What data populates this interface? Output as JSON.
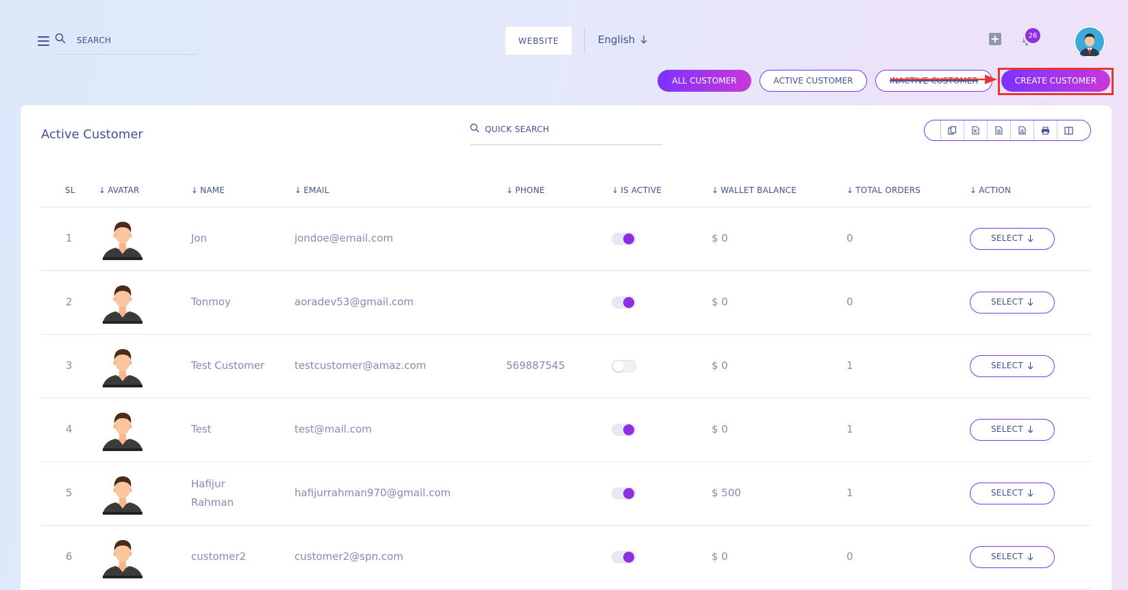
{
  "topbar": {
    "search_placeholder": "SEARCH",
    "website_label": "WEBSITE",
    "language": "English",
    "notification_count": "26"
  },
  "filters": {
    "all": "ALL CUSTOMER",
    "active": "ACTIVE CUSTOMER",
    "inactive": "INACTIVE CUSTOMER",
    "create": "CREATE CUSTOMER"
  },
  "card": {
    "title": "Active Customer",
    "quick_search_placeholder": "QUICK SEARCH"
  },
  "table": {
    "headers": [
      "SL",
      "AVATAR",
      "NAME",
      "EMAIL",
      "PHONE",
      "IS ACTIVE",
      "WALLET BALANCE",
      "TOTAL ORDERS",
      "ACTION"
    ],
    "rows": [
      {
        "sl": "1",
        "name": "Jon",
        "email": "jondoe@email.com",
        "phone": "",
        "active": true,
        "wallet": "$ 0",
        "orders": "0",
        "action": "SELECT"
      },
      {
        "sl": "2",
        "name": "Tonmoy",
        "email": "aoradev53@gmail.com",
        "phone": "",
        "active": true,
        "wallet": "$ 0",
        "orders": "0",
        "action": "SELECT"
      },
      {
        "sl": "3",
        "name": "Test Customer",
        "email": "testcustomer@amaz.com",
        "phone": "569887545",
        "active": false,
        "wallet": "$ 0",
        "orders": "1",
        "action": "SELECT"
      },
      {
        "sl": "4",
        "name": "Test",
        "email": "test@mail.com",
        "phone": "",
        "active": true,
        "wallet": "$ 0",
        "orders": "1",
        "action": "SELECT"
      },
      {
        "sl": "5",
        "name": "Hafijur Rahman",
        "email": "hafijurrahman970@gmail.com",
        "phone": "",
        "active": true,
        "wallet": "$ 500",
        "orders": "1",
        "action": "SELECT"
      },
      {
        "sl": "6",
        "name": "customer2",
        "email": "customer2@spn.com",
        "phone": "",
        "active": true,
        "wallet": "$ 0",
        "orders": "0",
        "action": "SELECT"
      }
    ]
  },
  "colors": {
    "accent": "#7c32ff",
    "accent_end": "#c738d8",
    "text": "#415094",
    "muted_text": "#828bb2",
    "highlight": "#e83434"
  },
  "icons": {
    "menu": "hamburger-icon",
    "search": "search-icon",
    "add": "plus-square-icon",
    "notifications": "bell-icon",
    "export": [
      "copy-icon",
      "excel-icon",
      "csv-icon",
      "pdf-icon",
      "print-icon",
      "columns-icon"
    ]
  }
}
